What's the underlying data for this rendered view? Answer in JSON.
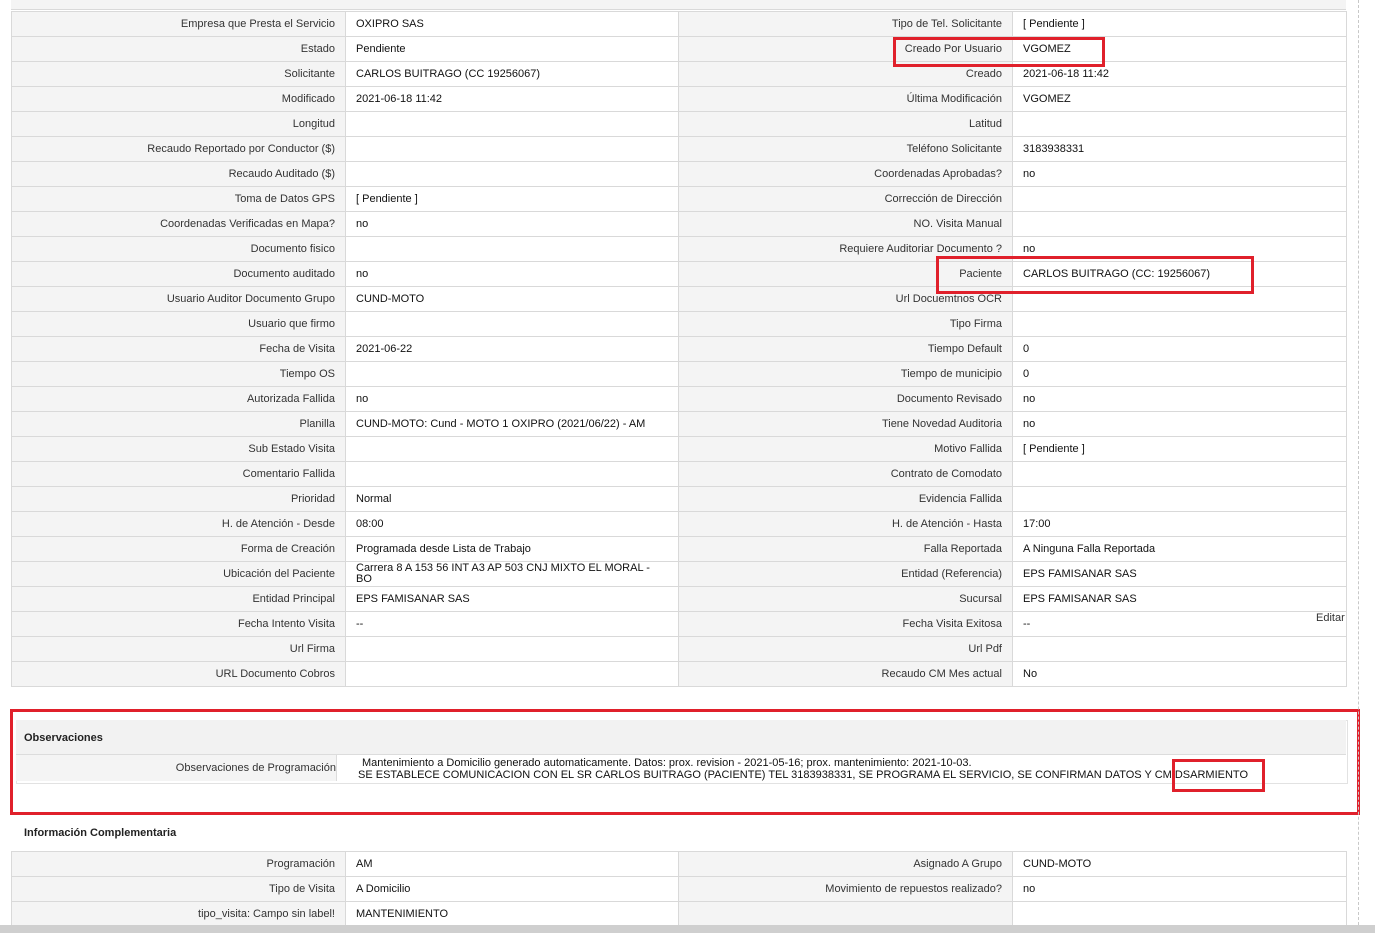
{
  "main_fields": [
    [
      "Empresa que Presta el Servicio",
      "OXIPRO SAS",
      "Tipo de Tel. Solicitante",
      "[ Pendiente ]"
    ],
    [
      "Estado",
      "Pendiente",
      "Creado Por Usuario",
      "VGOMEZ"
    ],
    [
      "Solicitante",
      "CARLOS BUITRAGO (CC 19256067)",
      "Creado",
      "2021-06-18 11:42"
    ],
    [
      "Modificado",
      "2021-06-18 11:42",
      "Última Modificación",
      " VGOMEZ"
    ],
    [
      "Longitud",
      "",
      "Latitud",
      ""
    ],
    [
      "Recaudo Reportado por Conductor ($)",
      "",
      "Teléfono Solicitante",
      "3183938331"
    ],
    [
      "Recaudo Auditado ($)",
      "",
      "Coordenadas Aprobadas?",
      " no"
    ],
    [
      "Toma de Datos GPS",
      "[ Pendiente ]",
      "Corrección de Dirección",
      ""
    ],
    [
      "Coordenadas Verificadas en Mapa?",
      " no",
      "NO. Visita Manual",
      ""
    ],
    [
      "Documento fisico",
      "",
      "Requiere Auditoriar Documento ?",
      " no"
    ],
    [
      "Documento auditado",
      " no",
      "Paciente",
      "CARLOS BUITRAGO (CC: 19256067)"
    ],
    [
      "Usuario Auditor Documento Grupo",
      "CUND-MOTO",
      "Url Docuemtnos OCR",
      ""
    ],
    [
      "Usuario que firmo",
      "",
      "Tipo Firma",
      ""
    ],
    [
      "Fecha de Visita",
      " 2021-06-22",
      "Tiempo Default",
      "0"
    ],
    [
      "Tiempo OS",
      "",
      "Tiempo de municipio",
      "0"
    ],
    [
      "Autorizada Fallida",
      " no",
      "Documento Revisado",
      " no"
    ],
    [
      "Planilla",
      "CUND-MOTO: Cund - MOTO 1 OXIPRO (2021/06/22) - AM",
      "Tiene Novedad Auditoria",
      " no"
    ],
    [
      "Sub Estado Visita",
      "",
      "Motivo Fallida",
      "[ Pendiente ]"
    ],
    [
      "Comentario Fallida",
      "",
      "Contrato de Comodato",
      ""
    ],
    [
      "Prioridad",
      "Normal",
      "Evidencia Fallida",
      ""
    ],
    [
      "H. de Atención - Desde",
      "08:00",
      "H. de Atención - Hasta",
      "17:00"
    ],
    [
      "Forma de Creación",
      "Programada desde Lista de Trabajo",
      "Falla Reportada",
      "A Ninguna Falla Reportada"
    ],
    [
      "Ubicación del Paciente",
      "Carrera 8 A 153 56 INT A3 AP 503 CNJ MIXTO EL MORAL - BO",
      "Entidad (Referencia)",
      "EPS FAMISANAR SAS"
    ],
    [
      "Entidad Principal",
      "EPS FAMISANAR SAS",
      "Sucursal",
      "EPS FAMISANAR SAS"
    ],
    [
      "Fecha Intento Visita",
      " --",
      "Fecha Visita Exitosa",
      " --"
    ],
    [
      "Url Firma",
      "",
      "Url Pdf",
      ""
    ],
    [
      "URL Documento Cobros",
      "",
      "Recaudo CM Mes actual",
      "No"
    ]
  ],
  "edit_link": "Editar",
  "observaciones": {
    "title": "Observaciones",
    "label": "Observaciones de Programación",
    "line1": "Mantenimiento a Domicilio generado automaticamente. Datos: prox. revision - 2021-05-16; prox. mantenimiento: 2021-10-03.",
    "line2": "SE ESTABLECE COMUNICACION CON EL SR CARLOS BUITRAGO (PACIENTE) TEL 3183938331, SE PROGRAMA EL SERVICIO, SE CONFIRMAN DATOS Y CM DSARMIENTO"
  },
  "complementaria": {
    "title": "Información Complementaria",
    "rows": [
      [
        "Programación",
        "AM",
        "Asignado A Grupo",
        "CUND-MOTO"
      ],
      [
        "Tipo de Visita",
        "A Domicilio",
        "Movimiento de repuestos realizado?",
        " no"
      ],
      [
        "tipo_visita: Campo sin label!",
        "MANTENIMIENTO",
        "",
        ""
      ]
    ]
  },
  "highlight_color": "#e0202b"
}
